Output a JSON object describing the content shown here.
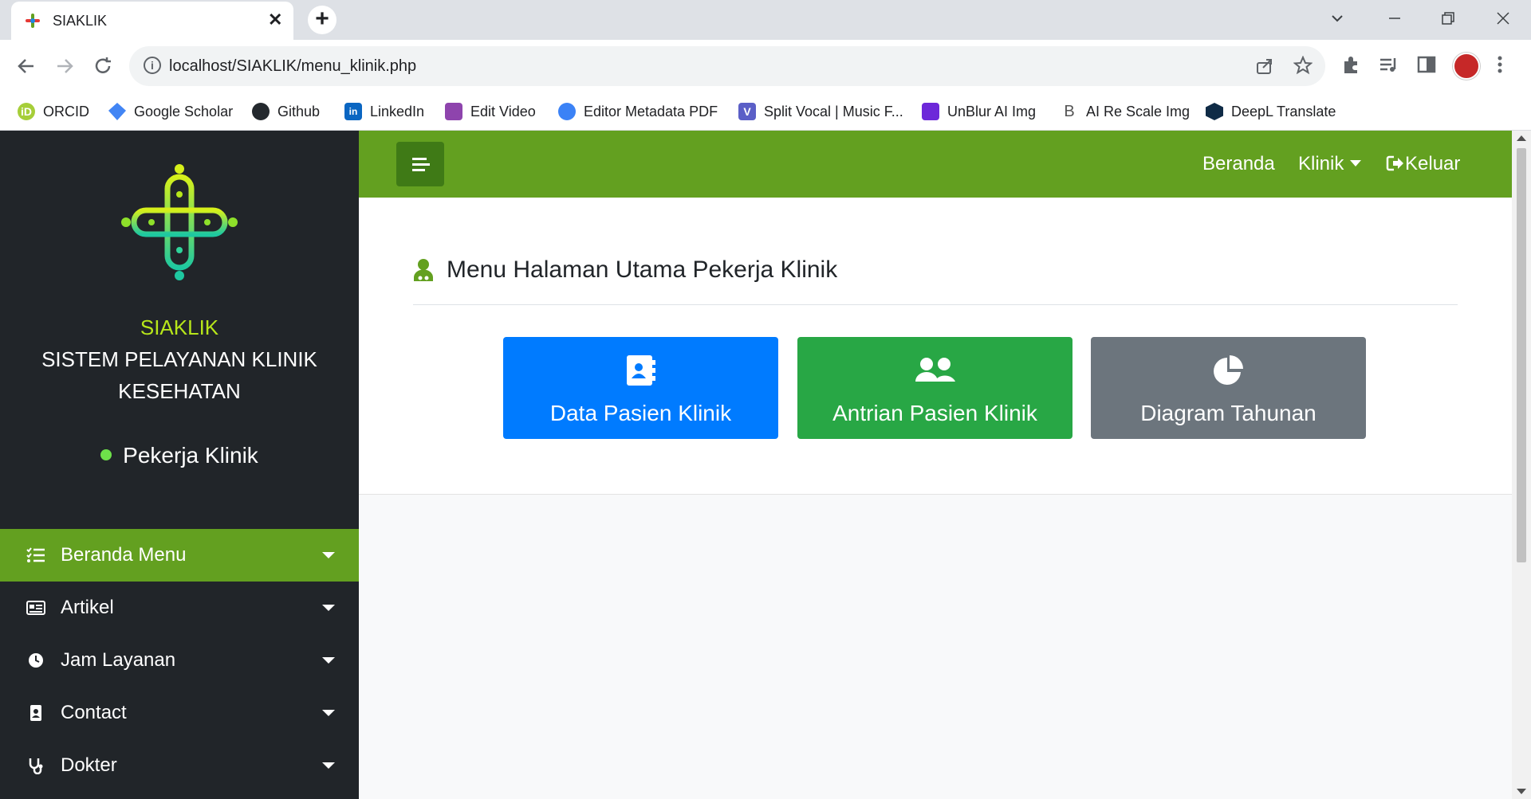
{
  "browser": {
    "tab_title": "SIAKLIK",
    "close_glyph": "✕",
    "new_tab_glyph": "+",
    "url": "localhost/SIAKLIK/menu_klinik.php",
    "bookmarks": [
      {
        "label": "ORCID",
        "icon": "orcid-icon",
        "color": "#a6ce39"
      },
      {
        "label": "Google Scholar",
        "icon": "google-scholar-icon",
        "color": "#4285f4"
      },
      {
        "label": "Github",
        "icon": "github-icon",
        "color": "#24292e"
      },
      {
        "label": "LinkedIn",
        "icon": "linkedin-icon",
        "color": "#0a66c2"
      },
      {
        "label": "Edit Video",
        "icon": "edit-video-icon",
        "color": "#8e44ad"
      },
      {
        "label": "Editor Metadata PDF",
        "icon": "metadata-icon",
        "color": "#3b82f6"
      },
      {
        "label": "Split Vocal | Music F...",
        "icon": "split-vocal-icon",
        "color": "#5b5fc7"
      },
      {
        "label": "UnBlur AI Img",
        "icon": "unblur-icon",
        "color": "#6d28d9"
      },
      {
        "label": "AI Re Scale Img",
        "icon": "rescale-icon",
        "color": "#555555"
      },
      {
        "label": "DeepL Translate",
        "icon": "deepl-icon",
        "color": "#0f2b46"
      }
    ]
  },
  "app": {
    "brand_name": "SIAKLIK",
    "brand_subtitle": "SISTEM PELAYANAN KLINIK KESEHATAN",
    "user_role": "Pekerja Klinik",
    "sidebar": [
      {
        "label": "Beranda Menu",
        "icon": "list-check-icon",
        "active": true
      },
      {
        "label": "Artikel",
        "icon": "newspaper-icon",
        "active": false
      },
      {
        "label": "Jam Layanan",
        "icon": "clock-icon",
        "active": false
      },
      {
        "label": "Contact",
        "icon": "contact-card-icon",
        "active": false
      },
      {
        "label": "Dokter",
        "icon": "stethoscope-icon",
        "active": false
      }
    ],
    "topnav": {
      "home": "Beranda",
      "clinic": "Klinik",
      "logout": "Keluar"
    },
    "page_title": "Menu Halaman Utama Pekerja Klinik",
    "cards": [
      {
        "label": "Data Pasien Klinik",
        "icon": "address-book-icon",
        "color": "#007bff"
      },
      {
        "label": "Antrian Pasien Klinik",
        "icon": "users-icon",
        "color": "#28a745"
      },
      {
        "label": "Diagram Tahunan",
        "icon": "pie-chart-icon",
        "color": "#6c757d"
      }
    ],
    "colors": {
      "primary_green": "#63a020",
      "dark_green": "#3f7a16",
      "sidebar_bg": "#212529",
      "brand_accent": "#b7e61a"
    }
  }
}
